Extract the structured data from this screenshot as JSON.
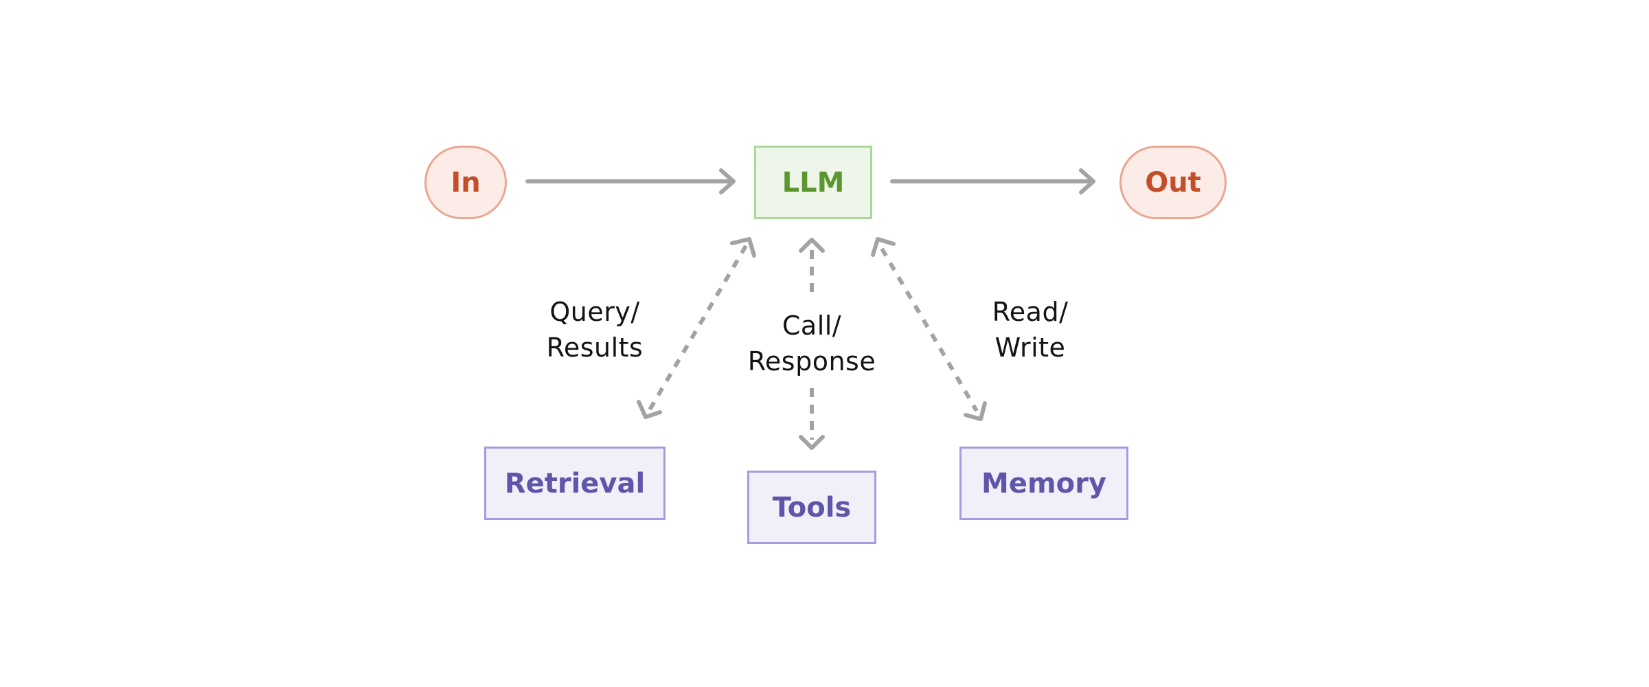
{
  "diagram": {
    "nodes": {
      "input": {
        "label": "In"
      },
      "llm": {
        "label": "LLM"
      },
      "output": {
        "label": "Out"
      },
      "retrieval": {
        "label": "Retrieval"
      },
      "tools": {
        "label": "Tools"
      },
      "memory": {
        "label": "Memory"
      }
    },
    "edges": [
      {
        "from": "In",
        "to": "LLM",
        "style": "solid",
        "direction": "forward"
      },
      {
        "from": "LLM",
        "to": "Out",
        "style": "solid",
        "direction": "forward"
      },
      {
        "from": "LLM",
        "to": "Retrieval",
        "style": "dashed",
        "direction": "bidirectional",
        "label": "Query/\nResults"
      },
      {
        "from": "LLM",
        "to": "Tools",
        "style": "dashed",
        "direction": "bidirectional",
        "label": "Call/\nResponse"
      },
      {
        "from": "LLM",
        "to": "Memory",
        "style": "dashed",
        "direction": "bidirectional",
        "label": "Read/\nWrite"
      }
    ],
    "edge_labels": {
      "retrieval": "Query/\nResults",
      "tools": "Call/\nResponse",
      "memory": "Read/\nWrite"
    },
    "colors": {
      "terminal_fill": "#fbece8",
      "terminal_stroke": "#eba692",
      "terminal_text": "#c24f2a",
      "llm_fill": "#eef6ea",
      "llm_stroke": "#a9d99a",
      "llm_text": "#5b962f",
      "aux_fill": "#f1f0f8",
      "aux_stroke": "#a69be0",
      "aux_text": "#5f55a9",
      "arrow": "#a3a3a1",
      "label_text": "#141414"
    }
  }
}
